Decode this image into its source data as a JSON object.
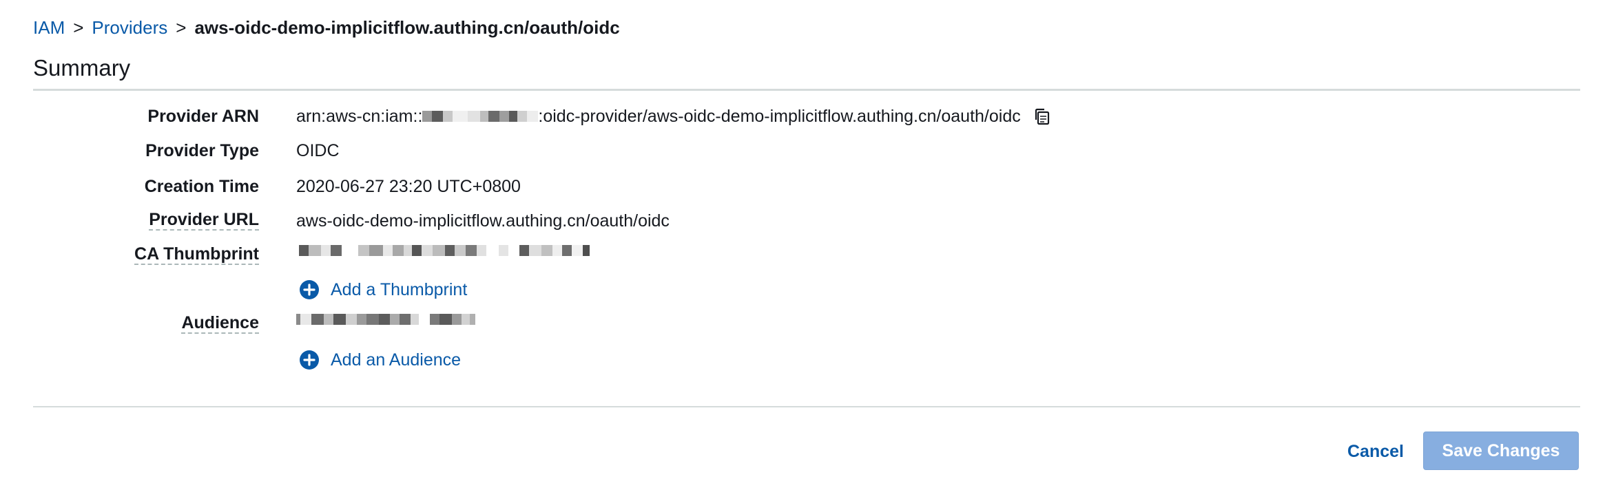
{
  "breadcrumb": {
    "items": [
      "IAM",
      "Providers"
    ],
    "separator": ">",
    "current": "aws-oidc-demo-implicitflow.authing.cn/oauth/oidc"
  },
  "summary": {
    "title": "Summary"
  },
  "details": {
    "provider_arn": {
      "label": "Provider ARN",
      "prefix": "arn:aws-cn:iam::",
      "suffix": ":oidc-provider/aws-oidc-demo-implicitflow.authing.cn/oauth/oidc",
      "copy_icon": "copy-icon"
    },
    "provider_type": {
      "label": "Provider Type",
      "value": "OIDC"
    },
    "creation_time": {
      "label": "Creation Time",
      "value": "2020-06-27 23:20 UTC+0800"
    },
    "provider_url": {
      "label": "Provider URL",
      "value": "aws-oidc-demo-implicitflow.authing.cn/oauth/oidc"
    },
    "ca_thumbprint": {
      "label": "CA Thumbprint",
      "add_label": "Add a Thumbprint",
      "add_icon": "plus-circle-icon"
    },
    "audience": {
      "label": "Audience",
      "add_label": "Add an Audience",
      "add_icon": "plus-circle-icon"
    }
  },
  "footer": {
    "cancel_label": "Cancel",
    "save_label": "Save Changes"
  },
  "colors": {
    "link": "#0a5aa8",
    "primary_disabled": "#87aee0",
    "divider": "#d5dbdb",
    "text": "#16191f"
  }
}
